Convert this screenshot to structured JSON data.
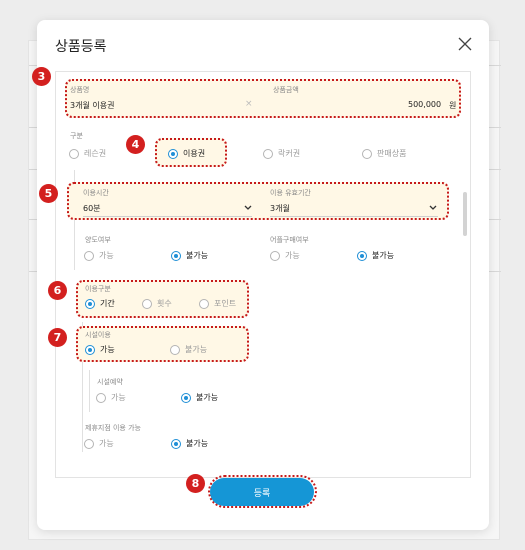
{
  "modal": {
    "title": "상품등록",
    "close_icon": "close-icon"
  },
  "product": {
    "name_label": "상품명",
    "name_value": "3개월 이용권",
    "price_label": "상품금액",
    "price_value": "500,000",
    "price_unit": "원"
  },
  "category": {
    "label": "구분",
    "options": [
      "레슨권",
      "이용권",
      "락커권",
      "판매상품"
    ],
    "selected": "이용권"
  },
  "usage": {
    "time_label": "이용시간",
    "time_value": "60분",
    "period_label": "이용 유효기간",
    "period_value": "3개월"
  },
  "transfer": {
    "label": "양도여부",
    "options": [
      "가능",
      "불가능"
    ],
    "selected": "불가능"
  },
  "group_buy": {
    "label": "어플구매여부",
    "options": [
      "가능",
      "불가능"
    ],
    "selected": "불가능"
  },
  "usage_type": {
    "label": "이용구분",
    "options": [
      "기간",
      "횟수",
      "포인트"
    ],
    "selected": "기간"
  },
  "facility": {
    "label": "시설이용",
    "options": [
      "가능",
      "불가능"
    ],
    "selected": "가능"
  },
  "reservation": {
    "label": "시설예약",
    "options": [
      "가능",
      "불가능"
    ],
    "selected": "불가능"
  },
  "partner": {
    "label": "제휴지점 이용 가능",
    "options": [
      "가능",
      "불가능"
    ],
    "selected": "불가능"
  },
  "submit_label": "등록",
  "badges": [
    "3",
    "4",
    "5",
    "6",
    "7",
    "8"
  ],
  "colors": {
    "accent": "#1596d6",
    "annotation": "#d3201f",
    "highlight_bg": "#fff8e6"
  }
}
